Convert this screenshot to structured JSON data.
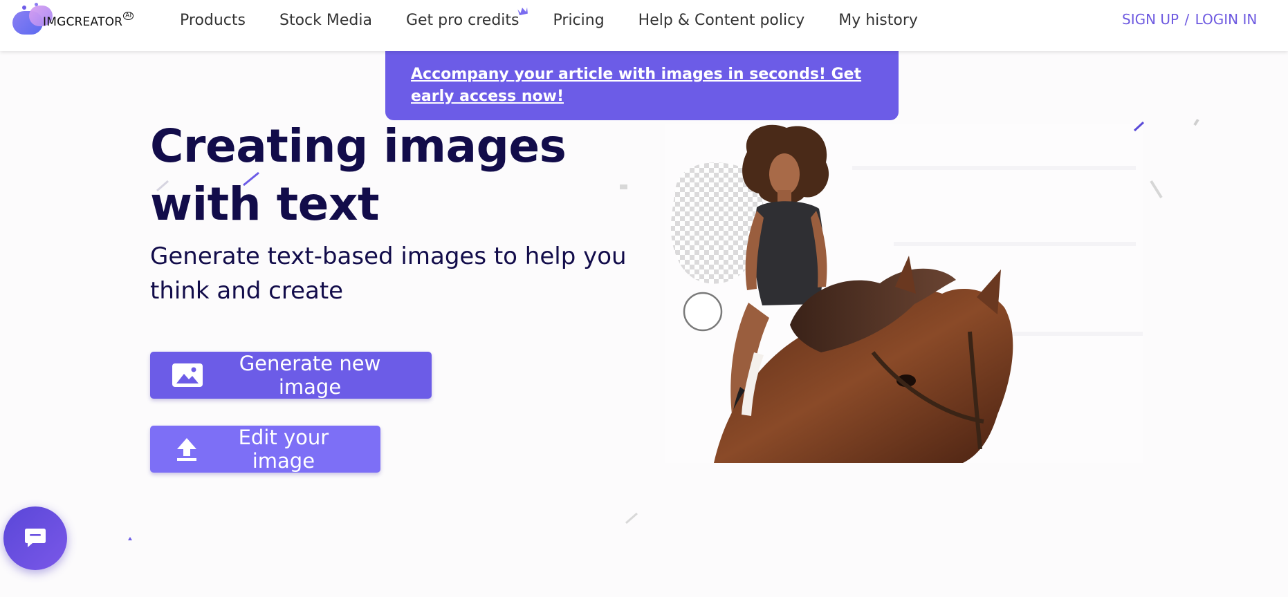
{
  "brand": {
    "name": "IMGCREATOR",
    "badge": "AI"
  },
  "nav": {
    "items": [
      {
        "label": "Products"
      },
      {
        "label": "Stock Media"
      },
      {
        "label": "Get pro credits",
        "icon": "crown-icon"
      },
      {
        "label": "Pricing"
      },
      {
        "label": "Help & Content policy"
      },
      {
        "label": "My history"
      }
    ],
    "signup": "SIGN UP",
    "separator": "/",
    "login": "LOGIN IN"
  },
  "banner": {
    "text": "Accompany your article with images in seconds! Get early access now!"
  },
  "hero": {
    "title_line1": "Creating images",
    "title_line2": "with text",
    "subtitle": "Generate text-based images to help you think and create",
    "primary_button": {
      "label": "Generate new image",
      "icon": "image-icon"
    },
    "secondary_button": {
      "label": "Edit your image",
      "icon": "upload-icon"
    }
  },
  "illustration": {
    "description_icon": "woman-riding-horse-image"
  },
  "chat": {
    "icon": "chat-icon"
  },
  "colors": {
    "accent": "#6c5ce7",
    "accent_light": "#7d6ff6",
    "heading": "#120c4a",
    "auth_link": "#6d59e0"
  }
}
